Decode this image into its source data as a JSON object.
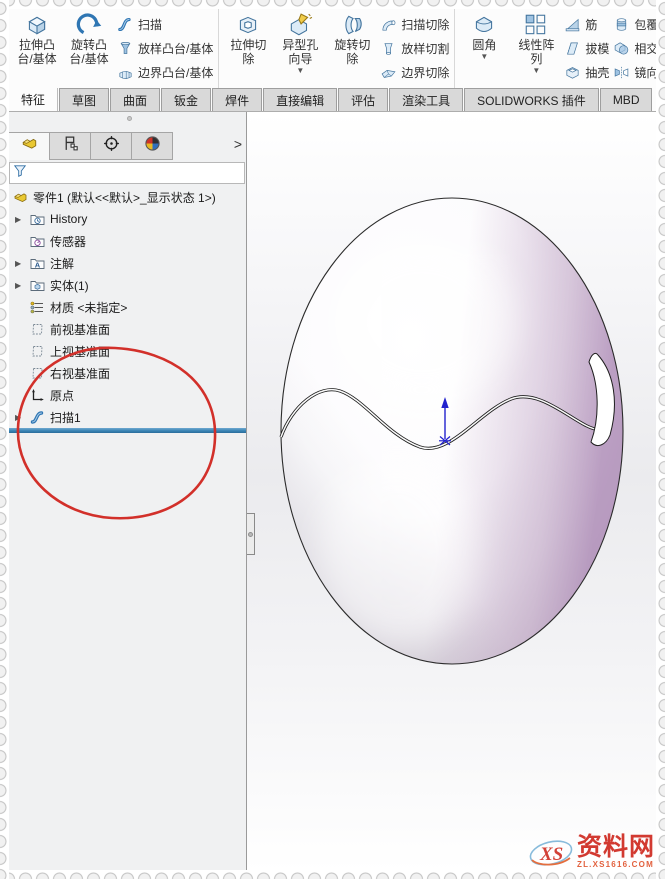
{
  "ribbon": {
    "groups": [
      {
        "name": "boss-base",
        "large": [
          {
            "name": "extrude-boss",
            "label": "拉伸凸\n台/基体",
            "icon": "extrude-boss"
          },
          {
            "name": "revolve-boss",
            "label": "旋转凸\n台/基体",
            "icon": "revolve-boss"
          }
        ],
        "stacks": [
          [
            {
              "name": "sweep",
              "label": "扫描",
              "icon": "sweep"
            },
            {
              "name": "loft-boss",
              "label": "放样凸台/基体",
              "icon": "loft"
            },
            {
              "name": "boundary-boss",
              "label": "边界凸台/基体",
              "icon": "boundary"
            }
          ]
        ]
      },
      {
        "name": "cut",
        "large": [
          {
            "name": "extrude-cut",
            "label": "拉伸切\n除",
            "icon": "extrude-cut"
          },
          {
            "name": "hole-wizard",
            "label": "异型孔\n向导",
            "icon": "hole-wizard",
            "dropdown": true
          },
          {
            "name": "revolve-cut",
            "label": "旋转切\n除",
            "icon": "revolve-cut"
          }
        ],
        "stacks": [
          [
            {
              "name": "sweep-cut",
              "label": "扫描切除",
              "icon": "sweep-cut"
            },
            {
              "name": "loft-cut",
              "label": "放样切割",
              "icon": "loft-cut"
            },
            {
              "name": "boundary-cut",
              "label": "边界切除",
              "icon": "boundary-cut"
            }
          ]
        ]
      },
      {
        "name": "features",
        "large": [
          {
            "name": "fillet",
            "label": "圆角",
            "icon": "fillet",
            "dropdown": true
          },
          {
            "name": "linear-pattern",
            "label": "线性阵\n列",
            "icon": "linear-pattern",
            "dropdown": true
          }
        ],
        "stacks": [
          [
            {
              "name": "rib",
              "label": "筋",
              "icon": "rib"
            },
            {
              "name": "draft",
              "label": "拔模",
              "icon": "draft"
            },
            {
              "name": "shell",
              "label": "抽壳",
              "icon": "shell"
            }
          ],
          [
            {
              "name": "wrap",
              "label": "包覆",
              "icon": "wrap"
            },
            {
              "name": "intersect",
              "label": "相交",
              "icon": "intersect"
            },
            {
              "name": "mirror",
              "label": "镜向",
              "icon": "mirror"
            }
          ]
        ]
      }
    ],
    "tabs": [
      {
        "name": "features",
        "label": "特征",
        "active": true
      },
      {
        "name": "sketch",
        "label": "草图"
      },
      {
        "name": "surfaces",
        "label": "曲面"
      },
      {
        "name": "sheet-metal",
        "label": "钣金"
      },
      {
        "name": "weldments",
        "label": "焊件"
      },
      {
        "name": "direct-editing",
        "label": "直接编辑"
      },
      {
        "name": "evaluate",
        "label": "评估"
      },
      {
        "name": "render-tools",
        "label": "渲染工具"
      },
      {
        "name": "solidworks-addins",
        "label": "SOLIDWORKS 插件"
      },
      {
        "name": "mbd",
        "label": "MBD"
      }
    ]
  },
  "sidebar": {
    "tabs": [
      {
        "name": "feature-manager",
        "icon": "pm-part",
        "active": true
      },
      {
        "name": "property-manager",
        "icon": "pm-property",
        "active": false
      },
      {
        "name": "configuration-manager",
        "icon": "pm-config",
        "active": false
      },
      {
        "name": "display-manager",
        "icon": "pm-display",
        "active": false
      }
    ],
    "expand_arrow": ">",
    "filter_value": "",
    "tree_root": "零件1 (默认<<默认>_显示状态 1>)",
    "tree": [
      {
        "name": "history",
        "label": "History",
        "icon": "history-folder",
        "expandable": true
      },
      {
        "name": "sensors",
        "label": "传感器",
        "icon": "sensors-folder",
        "expandable": false
      },
      {
        "name": "annotations",
        "label": "注解",
        "icon": "annotations-folder",
        "expandable": true
      },
      {
        "name": "solid-bodies",
        "label": "实体(1)",
        "icon": "solids-folder",
        "expandable": true
      },
      {
        "name": "material",
        "label": "材质 <未指定>",
        "icon": "material",
        "expandable": false
      },
      {
        "name": "front-plane",
        "label": "前视基准面",
        "icon": "plane",
        "expandable": false
      },
      {
        "name": "top-plane",
        "label": "上视基准面",
        "icon": "plane",
        "expandable": false
      },
      {
        "name": "right-plane",
        "label": "右视基准面",
        "icon": "plane",
        "expandable": false
      },
      {
        "name": "origin",
        "label": "原点",
        "icon": "origin",
        "expandable": false
      },
      {
        "name": "sweep1",
        "label": "扫描1",
        "icon": "sweep-feature",
        "expandable": true
      }
    ]
  },
  "watermark": {
    "logo": "XS",
    "site_name": "资料网",
    "site_url": "ZL.XS1616.COM"
  },
  "colors": {
    "rollback_bar": "#3a85b5",
    "annotation_circle": "#d2302a",
    "origin_arrow": "#2121cd",
    "egg_lavender": "#c9b3cd",
    "watermark_red": "#cf2a20"
  }
}
